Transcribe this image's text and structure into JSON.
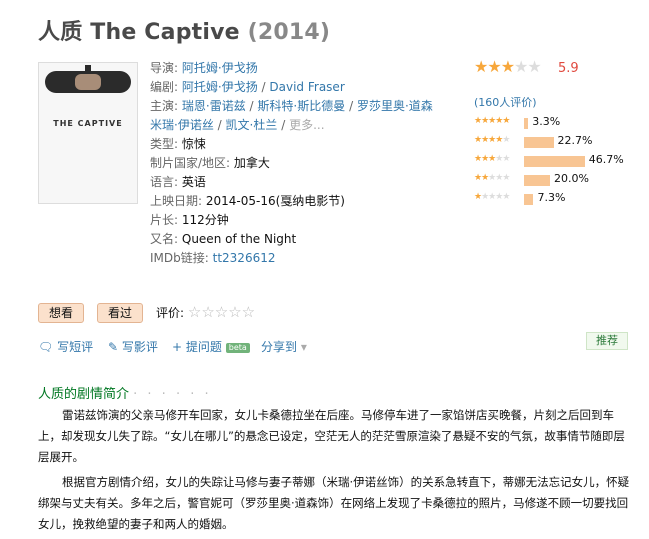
{
  "title": {
    "name": "人质 The Captive",
    "year": "(2014)"
  },
  "info": {
    "director_label": "导演:",
    "director": "阿托姆·伊戈扬",
    "writer_label": "编剧:",
    "writers": [
      "阿托姆·伊戈扬",
      "David Fraser"
    ],
    "cast_label": "主演:",
    "cast": [
      "瑞恩·雷诺兹",
      "斯科特·斯比德曼",
      "罗莎里奥·道森",
      "米瑞·伊诺丝",
      "凯文·杜兰"
    ],
    "more": "更多...",
    "genre_label": "类型:",
    "genre": "惊悚",
    "country_label": "制片国家/地区:",
    "country": "加拿大",
    "language_label": "语言:",
    "language": "英语",
    "release_label": "上映日期:",
    "release": "2014-05-16(戛纳电影节)",
    "runtime_label": "片长:",
    "runtime": "112分钟",
    "aka_label": "又名:",
    "aka": "Queen of the Night",
    "imdb_label": "IMDb链接:",
    "imdb": "tt2326612"
  },
  "rating": {
    "score": "5.9",
    "stars_filled": 3,
    "count_text": "(160人评价)",
    "distribution": [
      {
        "stars": 5,
        "pct": 3.3,
        "label": "3.3%"
      },
      {
        "stars": 4,
        "pct": 22.7,
        "label": "22.7%"
      },
      {
        "stars": 3,
        "pct": 46.7,
        "label": "46.7%"
      },
      {
        "stars": 2,
        "pct": 20.0,
        "label": "20.0%"
      },
      {
        "stars": 1,
        "pct": 7.3,
        "label": "7.3%"
      }
    ]
  },
  "buttons": {
    "want": "想看",
    "seen": "看过",
    "rate_label": "评价:"
  },
  "actions": {
    "short_review": "写短评",
    "review": "写影评",
    "question": "提问题",
    "beta": "beta",
    "share": "分享到",
    "recommend": "推荐"
  },
  "summary": {
    "heading": "人质的剧情简介",
    "dots": "· · · · · ·",
    "p1": "雷诺兹饰演的父亲马修开车回家，女儿卡桑德拉坐在后座。马修停车进了一家馅饼店买晚餐，片刻之后回到车上，却发现女儿失了踪。“女儿在哪儿”的悬念已设定，空茫无人的茫茫雪原渲染了悬疑不安的气氛，故事情节随即层层展开。",
    "p2": "根据官方剧情介绍，女儿的失踪让马修与妻子蒂娜（米瑞·伊诺丝饰）的关系急转直下，蒂娜无法忘记女儿，怀疑绑架与丈夫有关。多年之后，警官妮可（罗莎里奥·道森饰）在网络上发现了卡桑德拉的照片，马修遂不顾一切要找回女儿，挽救绝望的妻子和两人的婚姻。"
  },
  "poster": {
    "title": "THE CAPTIVE"
  },
  "colors": {
    "link": "#3377aa",
    "star": "#f7a73b",
    "bar": "#f8c593",
    "score": "#e04a3f",
    "heading": "#007722"
  }
}
